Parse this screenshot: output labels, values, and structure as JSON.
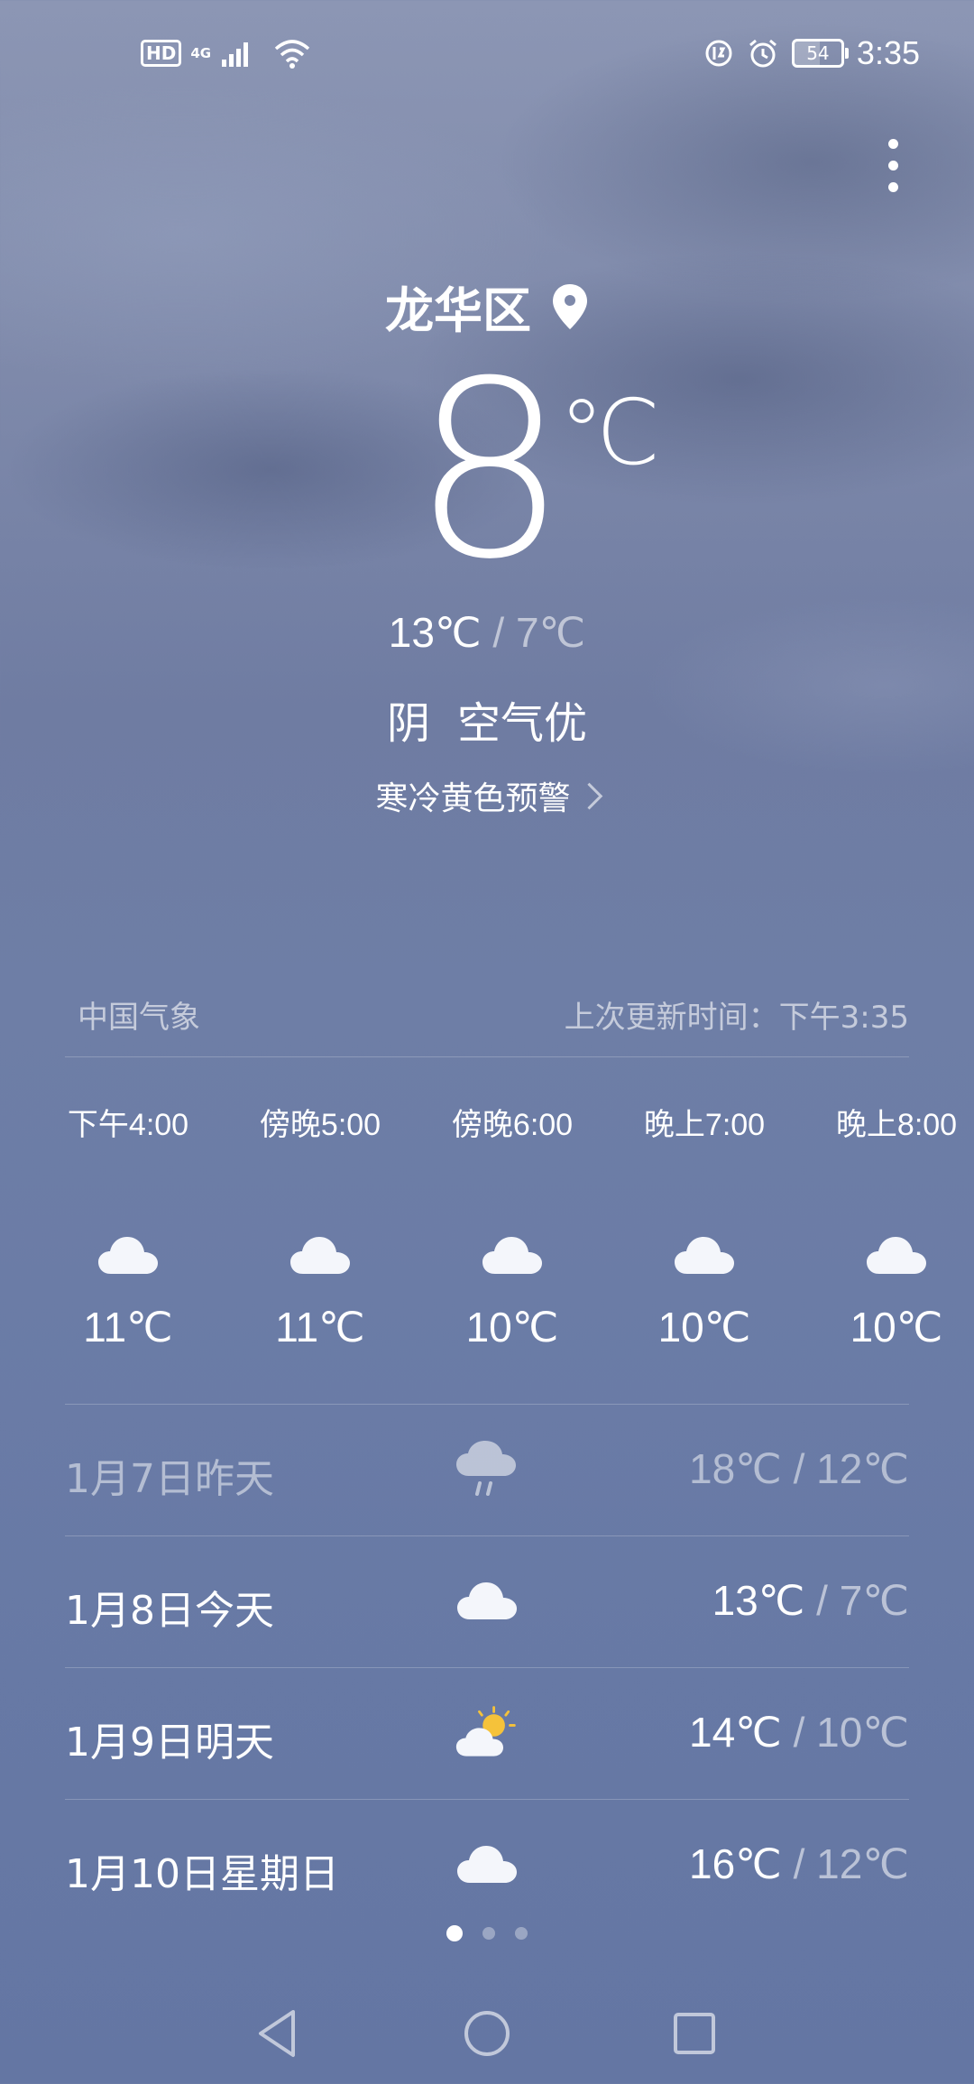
{
  "status_bar": {
    "hd": "HD",
    "network": "4G",
    "time": "3:35",
    "battery_level": "54"
  },
  "location": {
    "name": "龙华区"
  },
  "current": {
    "temperature": "8",
    "unit": "℃",
    "high": "13℃",
    "separator": " / ",
    "low": "7℃",
    "condition": "阴",
    "air_quality": "空气优",
    "alert": "寒冷黄色预警"
  },
  "source": {
    "provider": "中国气象",
    "updated": "上次更新时间：下午3:35"
  },
  "hourly": [
    {
      "time": "下午4:00",
      "icon": "cloudy-icon",
      "temp": "11℃"
    },
    {
      "time": "傍晚5:00",
      "icon": "cloudy-icon",
      "temp": "11℃"
    },
    {
      "time": "傍晚6:00",
      "icon": "cloudy-icon",
      "temp": "10℃"
    },
    {
      "time": "晚上7:00",
      "icon": "cloudy-icon",
      "temp": "10℃"
    },
    {
      "time": "晚上8:00",
      "icon": "cloudy-icon",
      "temp": "10℃"
    }
  ],
  "daily": [
    {
      "label": "1月7日昨天",
      "icon": "rain-cloud-icon",
      "high": "18℃",
      "sep": " / ",
      "low": "12℃"
    },
    {
      "label": "1月8日今天",
      "icon": "cloudy-icon",
      "high": "13℃",
      "sep": " / ",
      "low": "7℃"
    },
    {
      "label": "1月9日明天",
      "icon": "partly-sunny-icon",
      "high": "14℃",
      "sep": " / ",
      "low": "10℃"
    },
    {
      "label": "1月10日星期日",
      "icon": "cloudy-icon",
      "high": "16℃",
      "sep": " / ",
      "low": "12℃"
    }
  ],
  "pager": {
    "pages": 3,
    "active": 1
  },
  "colors": {
    "background_top": "#8c96b4",
    "background_bottom": "#6476a3",
    "sun": "#f5c23a"
  }
}
